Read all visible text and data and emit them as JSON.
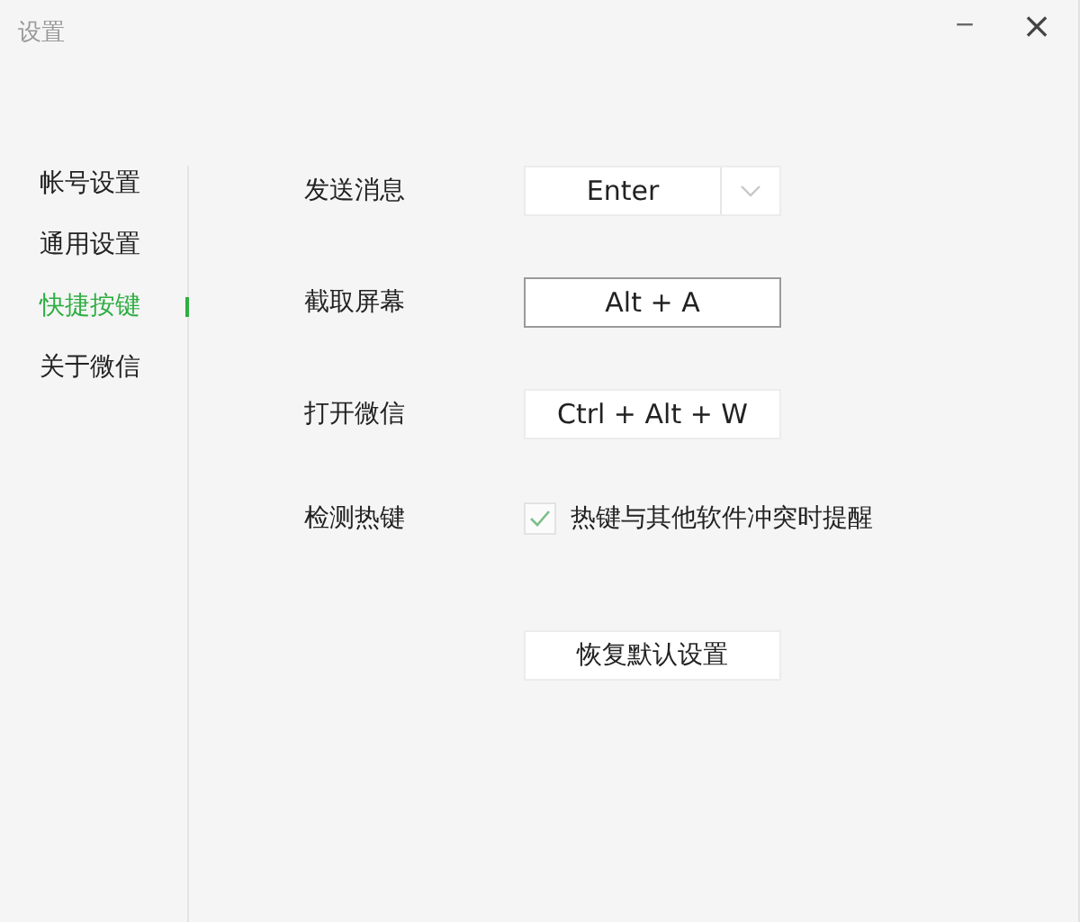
{
  "window": {
    "title": "设置",
    "controls": [
      {
        "kind": "minimize",
        "label": "−"
      },
      {
        "kind": "close",
        "label": "×"
      }
    ]
  },
  "sidebar": {
    "items": [
      {
        "label": "帐号设置",
        "selected": false
      },
      {
        "label": "通用设置",
        "selected": false
      },
      {
        "label": "快捷按键",
        "selected": true
      },
      {
        "label": "关于微信",
        "selected": false
      }
    ]
  },
  "settings": [
    {
      "kind": "dropdown",
      "label": "发送消息",
      "value": "Enter",
      "focused": false
    },
    {
      "kind": "key",
      "label": "截取屏幕",
      "value": "Alt + A",
      "focused": true
    },
    {
      "kind": "key",
      "label": "打开微信",
      "value": "Ctrl + Alt + W",
      "focused": false
    },
    {
      "kind": "checkbox",
      "label": "检测热键",
      "text": "热键与其他软件冲突时提醒",
      "checked": true
    }
  ],
  "reset_button": "恢复默认设置"
}
